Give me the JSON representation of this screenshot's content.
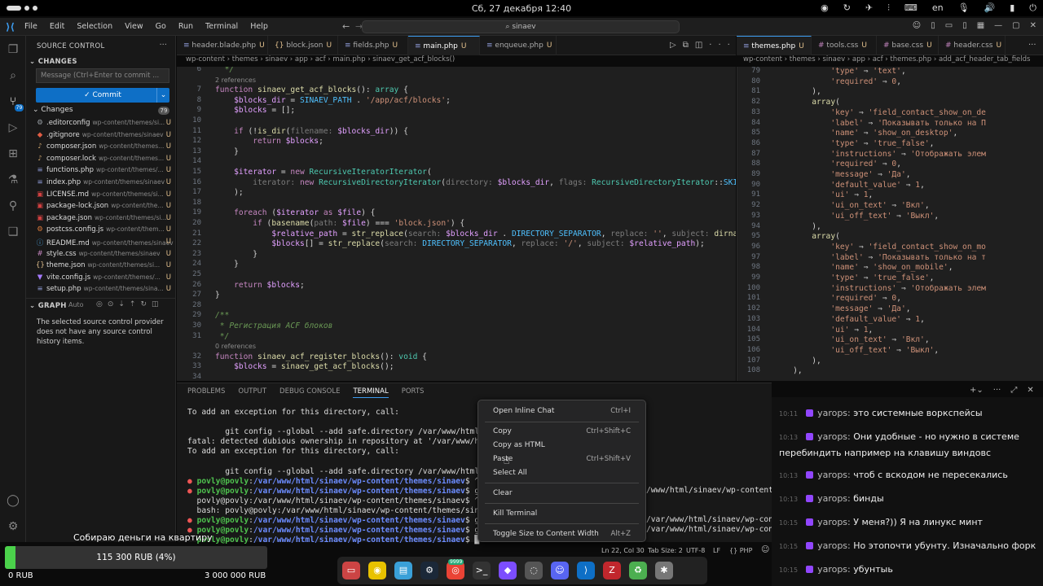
{
  "topbar": {
    "datetime": "Сб, 27 декабря  12:40",
    "lang": "en"
  },
  "menu": [
    "File",
    "Edit",
    "Selection",
    "View",
    "Go",
    "Run",
    "Terminal",
    "Help"
  ],
  "search": {
    "value": "sinaev"
  },
  "sidebar": {
    "title": "SOURCE CONTROL",
    "changes_header": "CHANGES",
    "message_placeholder": "Message (Ctrl+Enter to commit ...",
    "commit_label": "Commit",
    "changes_label": "Changes",
    "changes_count": "79",
    "files": [
      {
        "name": ".editorconfig",
        "path": "wp-content/themes/si...",
        "status": "U",
        "icon": "⚙",
        "color": "#9aa0a6"
      },
      {
        "name": ".gitignore",
        "path": "wp-content/themes/sinaev",
        "status": "U",
        "icon": "◆",
        "color": "#e05d44"
      },
      {
        "name": "composer.json",
        "path": "wp-content/themes...",
        "status": "U",
        "icon": "♪",
        "color": "#c9a26b"
      },
      {
        "name": "composer.lock",
        "path": "wp-content/themes...",
        "status": "U",
        "icon": "♪",
        "color": "#c9a26b"
      },
      {
        "name": "functions.php",
        "path": "wp-content/themes/...",
        "status": "U",
        "icon": "≡",
        "color": "#8f9bd8"
      },
      {
        "name": "index.php",
        "path": "wp-content/themes/sinaev",
        "status": "U",
        "icon": "≡",
        "color": "#8f9bd8"
      },
      {
        "name": "LICENSE.md",
        "path": "wp-content/themes/si...",
        "status": "U",
        "icon": "▣",
        "color": "#d04040"
      },
      {
        "name": "package-lock.json",
        "path": "wp-content/the...",
        "status": "U",
        "icon": "▣",
        "color": "#d04040"
      },
      {
        "name": "package.json",
        "path": "wp-content/themes/si...",
        "status": "U",
        "icon": "▣",
        "color": "#d04040"
      },
      {
        "name": "postcss.config.js",
        "path": "wp-content/them...",
        "status": "U",
        "icon": "⚙",
        "color": "#dd7a3a"
      },
      {
        "name": "README.md",
        "path": "wp-content/themes/sinaev",
        "status": "U",
        "icon": "ⓘ",
        "color": "#4aa3df"
      },
      {
        "name": "style.css",
        "path": "wp-content/themes/sinaev",
        "status": "U",
        "icon": "#",
        "color": "#c586c0"
      },
      {
        "name": "theme.json",
        "path": "wp-content/themes/si...",
        "status": "U",
        "icon": "{}",
        "color": "#e2c08d"
      },
      {
        "name": "vite.config.js",
        "path": "wp-content/themes/...",
        "status": "U",
        "icon": "▼",
        "color": "#a67bff"
      },
      {
        "name": "setup.php",
        "path": "wp-content/themes/sina...",
        "status": "U",
        "icon": "≡",
        "color": "#8f9bd8"
      }
    ],
    "graph_header": "GRAPH",
    "graph_auto": "Auto",
    "graph_message": "The selected source control provider does not have any source control history items."
  },
  "tabs_left": [
    {
      "label": "header.blade.php",
      "status": "U",
      "active": false
    },
    {
      "label": "block.json",
      "status": "U",
      "active": false
    },
    {
      "label": "fields.php",
      "status": "U",
      "active": false
    },
    {
      "label": "main.php",
      "status": "U",
      "active": true
    },
    {
      "label": "enqueue.php",
      "status": "U",
      "active": false
    }
  ],
  "tabs_right": [
    {
      "label": "themes.php",
      "status": "U",
      "active": true
    },
    {
      "label": "tools.css",
      "status": "U",
      "active": false
    },
    {
      "label": "base.css",
      "status": "U",
      "active": false
    },
    {
      "label": "header.css",
      "status": "U",
      "active": false
    }
  ],
  "breadcrumb_left": "wp-content › themes › sinaev › app › acf › main.php › sinaev_get_acf_blocks()",
  "breadcrumb_right": "wp-content › themes › sinaev › app › acf › themes.php › add_acf_header_tab_fields",
  "code_left": [
    {
      "ln": "6",
      "html": "  <span class='cm'>*/</span>"
    },
    {
      "ln": "",
      "html": "<span class='ref'>2 references</span>"
    },
    {
      "ln": "7",
      "html": "<span class='kw'>function</span> <span class='fn'>sinaev_get_acf_blocks</span>(): <span class='ty'>array</span> {"
    },
    {
      "ln": "8",
      "html": "    <span class='vr'>$blocks_dir</span> = <span class='cs'>SINAEV_PATH</span> . <span class='st'>'/app/acf/blocks'</span>;"
    },
    {
      "ln": "9",
      "html": "    <span class='vr'>$blocks</span> = [];"
    },
    {
      "ln": "10",
      "html": ""
    },
    {
      "ln": "11",
      "html": "    <span class='kw'>if</span> (!<span class='fn'>is_dir</span>(<span class='hn'>filename:</span> <span class='vr'>$blocks_dir</span>)) {"
    },
    {
      "ln": "12",
      "html": "        <span class='kw'>return</span> <span class='vr'>$blocks</span>;"
    },
    {
      "ln": "13",
      "html": "    }"
    },
    {
      "ln": "14",
      "html": ""
    },
    {
      "ln": "15",
      "html": "    <span class='vr'>$iterator</span> = <span class='kw'>new</span> <span class='ty'>RecursiveIteratorIterator</span>("
    },
    {
      "ln": "16",
      "html": "        <span class='hn'>iterator:</span> <span class='kw'>new</span> <span class='ty'>RecursiveDirectoryIterator</span>(<span class='hn'>directory:</span> <span class='vr'>$blocks_dir</span>, <span class='hn'>flags:</span> <span class='ty'>RecursiveDirectoryIterator</span>::<span class='cs'>SKI</span>"
    },
    {
      "ln": "17",
      "html": "    );"
    },
    {
      "ln": "18",
      "html": ""
    },
    {
      "ln": "19",
      "html": "    <span class='kw'>foreach</span> (<span class='vr'>$iterator</span> <span class='kw'>as</span> <span class='vr'>$file</span>) {"
    },
    {
      "ln": "20",
      "html": "        <span class='kw'>if</span> (<span class='fn'>basename</span>(<span class='hn'>path:</span> <span class='vr'>$file</span>) === <span class='st'>'block.json'</span>) {"
    },
    {
      "ln": "21",
      "html": "            <span class='vr'>$relative_path</span> = <span class='fn'>str_replace</span>(<span class='hn'>search:</span> <span class='vr'>$blocks_dir</span> . <span class='cs'>DIRECTORY_SEPARATOR</span>, <span class='hn'>replace:</span> <span class='st'>''</span>, <span class='hn'>subject:</span> <span class='fn'>dirna</span>"
    },
    {
      "ln": "22",
      "html": "            <span class='vr'>$blocks</span>[] = <span class='fn'>str_replace</span>(<span class='hn'>search:</span> <span class='cs'>DIRECTORY_SEPARATOR</span>, <span class='hn'>replace:</span> <span class='st'>'/'</span>, <span class='hn'>subject:</span> <span class='vr'>$relative_path</span>);"
    },
    {
      "ln": "23",
      "html": "        }"
    },
    {
      "ln": "24",
      "html": "    }"
    },
    {
      "ln": "25",
      "html": ""
    },
    {
      "ln": "26",
      "html": "    <span class='kw'>return</span> <span class='vr'>$blocks</span>;"
    },
    {
      "ln": "27",
      "html": "}"
    },
    {
      "ln": "28",
      "html": ""
    },
    {
      "ln": "29",
      "html": "<span class='cm'>/**</span>"
    },
    {
      "ln": "30",
      "html": "<span class='cm'> * Регистрация ACF блоков</span>"
    },
    {
      "ln": "31",
      "html": "<span class='cm'> */</span>"
    },
    {
      "ln": "",
      "html": "<span class='ref'>0 references</span>"
    },
    {
      "ln": "32",
      "html": "<span class='kw'>function</span> <span class='fn'>sinaev_acf_register_blocks</span>(): <span class='ty'>void</span> {"
    },
    {
      "ln": "33",
      "html": "    <span class='vr'>$blocks</span> = <span class='fn'>sinaev_get_acf_blocks</span>();"
    },
    {
      "ln": "34",
      "html": ""
    }
  ],
  "code_right": [
    {
      "ln": "79",
      "html": "            <span class='st'>'type'</span> ⇒ <span class='st'>'text'</span>,"
    },
    {
      "ln": "80",
      "html": "            <span class='st'>'required'</span> ⇒ <span class='st'>0</span>,"
    },
    {
      "ln": "81",
      "html": "        ),"
    },
    {
      "ln": "82",
      "html": "        <span class='fn'>array</span>("
    },
    {
      "ln": "83",
      "html": "            <span class='st'>'key'</span> ⇒ <span class='st'>'field_contact_show_on_de</span>"
    },
    {
      "ln": "84",
      "html": "            <span class='st'>'label'</span> ⇒ <span class='st'>'Показывать только на П</span>"
    },
    {
      "ln": "85",
      "html": "            <span class='st'>'name'</span> ⇒ <span class='st'>'show_on_desktop'</span>,"
    },
    {
      "ln": "86",
      "html": "            <span class='st'>'type'</span> ⇒ <span class='st'>'true_false'</span>,"
    },
    {
      "ln": "87",
      "html": "            <span class='st'>'instructions'</span> ⇒ <span class='st'>'Отображать элем</span>"
    },
    {
      "ln": "88",
      "html": "            <span class='st'>'required'</span> ⇒ <span class='st'>0</span>,"
    },
    {
      "ln": "89",
      "html": "            <span class='st'>'message'</span> ⇒ <span class='st'>'Да'</span>,"
    },
    {
      "ln": "90",
      "html": "            <span class='st'>'default_value'</span> ⇒ <span class='st'>1</span>,"
    },
    {
      "ln": "91",
      "html": "            <span class='st'>'ui'</span> ⇒ <span class='st'>1</span>,"
    },
    {
      "ln": "92",
      "html": "            <span class='st'>'ui_on_text'</span> ⇒ <span class='st'>'Вкл'</span>,"
    },
    {
      "ln": "93",
      "html": "            <span class='st'>'ui_off_text'</span> ⇒ <span class='st'>'Выкл'</span>,"
    },
    {
      "ln": "94",
      "html": "        ),"
    },
    {
      "ln": "95",
      "html": "        <span class='fn'>array</span>("
    },
    {
      "ln": "96",
      "html": "            <span class='st'>'key'</span> ⇒ <span class='st'>'field_contact_show_on_mo</span>"
    },
    {
      "ln": "97",
      "html": "            <span class='st'>'label'</span> ⇒ <span class='st'>'Показывать только на т</span>"
    },
    {
      "ln": "98",
      "html": "            <span class='st'>'name'</span> ⇒ <span class='st'>'show_on_mobile'</span>,"
    },
    {
      "ln": "99",
      "html": "            <span class='st'>'type'</span> ⇒ <span class='st'>'true_false'</span>,"
    },
    {
      "ln": "100",
      "html": "            <span class='st'>'instructions'</span> ⇒ <span class='st'>'Отображать элем</span>"
    },
    {
      "ln": "101",
      "html": "            <span class='st'>'required'</span> ⇒ <span class='st'>0</span>,"
    },
    {
      "ln": "102",
      "html": "            <span class='st'>'message'</span> ⇒ <span class='st'>'Да'</span>,"
    },
    {
      "ln": "103",
      "html": "            <span class='st'>'default_value'</span> ⇒ <span class='st'>1</span>,"
    },
    {
      "ln": "104",
      "html": "            <span class='st'>'ui'</span> ⇒ <span class='st'>1</span>,"
    },
    {
      "ln": "105",
      "html": "            <span class='st'>'ui_on_text'</span> ⇒ <span class='st'>'Вкл'</span>,"
    },
    {
      "ln": "106",
      "html": "            <span class='st'>'ui_off_text'</span> ⇒ <span class='st'>'Выкл'</span>,"
    },
    {
      "ln": "107",
      "html": "        ),"
    },
    {
      "ln": "108",
      "html": "    ),"
    }
  ],
  "panel": {
    "tabs": [
      "PROBLEMS",
      "OUTPUT",
      "DEBUG CONSOLE",
      "TERMINAL",
      "PORTS"
    ],
    "active_tab": "TERMINAL",
    "lines": [
      "<span>To add an exception for this directory, call:</span>",
      "",
      "<span>        git config --global --add safe.directory /var/www/html/sina</span>",
      "<span>fatal: detected dubious ownership in repository at '/var/www/h</span>",
      "<span>To add an exception for this directory, call:</span>",
      "",
      "<span>        git config --global --add safe.directory /var/www/html/sina</span>",
      "<span class='dot'>●</span> <span class='g'>povly@povly</span>:<span class='b'>/var/www/html/sinaev/wp-content/themes/sinaev</span>$ ^C",
      "<span class='dot'>●</span> <span class='g'>povly@povly</span>:<span class='b'>/var/www/html/sinaev/wp-content/themes/sinaev</span>$ git cont",
      "<span>  povly@povly:/var/www/html/sinaev/wp-content/themes/sinaev$ ^C</span>",
      "<span>  bash: povly@povly:/var/www/html/sinaev/wp-content/themes/sinaev$: N</span>",
      "<span class='dot'>●</span> <span class='g'>povly@povly</span>:<span class='b'>/var/www/html/sinaev/wp-content/themes/sinaev</span>$ git cont",
      "<span class='dot'>●</span> <span class='g'>povly@povly</span>:<span class='b'>/var/www/html/sinaev/wp-content/themes/sinaev</span>$ git cont",
      "<span>  </span><span class='g'>povly@povly</span>:<span class='b'>/var/www/html/sinaev/wp-content/themes/sinaev</span>$ █"
    ],
    "right_fragments": [
      "/www/html/sinaev/wp-content/the",
      "/var/www/html/sinaev/wp-content/the",
      "/var/www/html/sinaev/wp-content/the"
    ]
  },
  "context_menu": [
    {
      "label": "Open Inline Chat",
      "shortcut": "Ctrl+I"
    },
    {
      "label": "Copy",
      "shortcut": "Ctrl+Shift+C"
    },
    {
      "label": "Copy as HTML",
      "shortcut": ""
    },
    {
      "label": "Paste",
      "shortcut": "Ctrl+Shift+V"
    },
    {
      "label": "Select All",
      "shortcut": ""
    },
    {
      "label": "Clear",
      "shortcut": ""
    },
    {
      "label": "Kill Terminal",
      "shortcut": ""
    },
    {
      "label": "Toggle Size to Content Width",
      "shortcut": "Alt+Z"
    }
  ],
  "statusbar": {
    "position": "Ln 22, Col 30",
    "tab": "Tab Size: 2",
    "enc": "UTF-8",
    "eol": "LF",
    "lang": "PHP"
  },
  "chat": [
    {
      "time": "10:11",
      "user": "yarops:",
      "text": "это системные воркспейсы"
    },
    {
      "time": "10:13",
      "user": "yarops:",
      "text": "Они удобные - но нужно в системе перебиндить например на клавишу виндовс"
    },
    {
      "time": "10:13",
      "user": "yarops:",
      "text": "чтоб с вскодом не пересекались"
    },
    {
      "time": "10:13",
      "user": "yarops:",
      "text": "бинды"
    },
    {
      "time": "10:15",
      "user": "yarops:",
      "text": "У меня?)) Я на линукс минт"
    },
    {
      "time": "10:15",
      "user": "yarops:",
      "text": "Но этопочти убунту. Изначально форк"
    },
    {
      "time": "10:15",
      "user": "yarops:",
      "text": "убунтыь"
    }
  ],
  "donation": {
    "title": "Собираю деньги на квартиру",
    "progress_text": "115 300 RUB (4%)",
    "progress": 0.04,
    "min": "0 RUB",
    "max": "3 000 000 RUB"
  },
  "dock": {
    "badge": "9999",
    "icons": [
      "files-icon",
      "rhythmbox-icon",
      "notes-icon",
      "steam-icon",
      "chrome-icon",
      "terminal-icon",
      "obsidian-icon",
      "browser-icon",
      "discord-icon",
      "vscode-icon",
      "filezilla-icon",
      "trash-icon",
      "settings-icon"
    ]
  }
}
